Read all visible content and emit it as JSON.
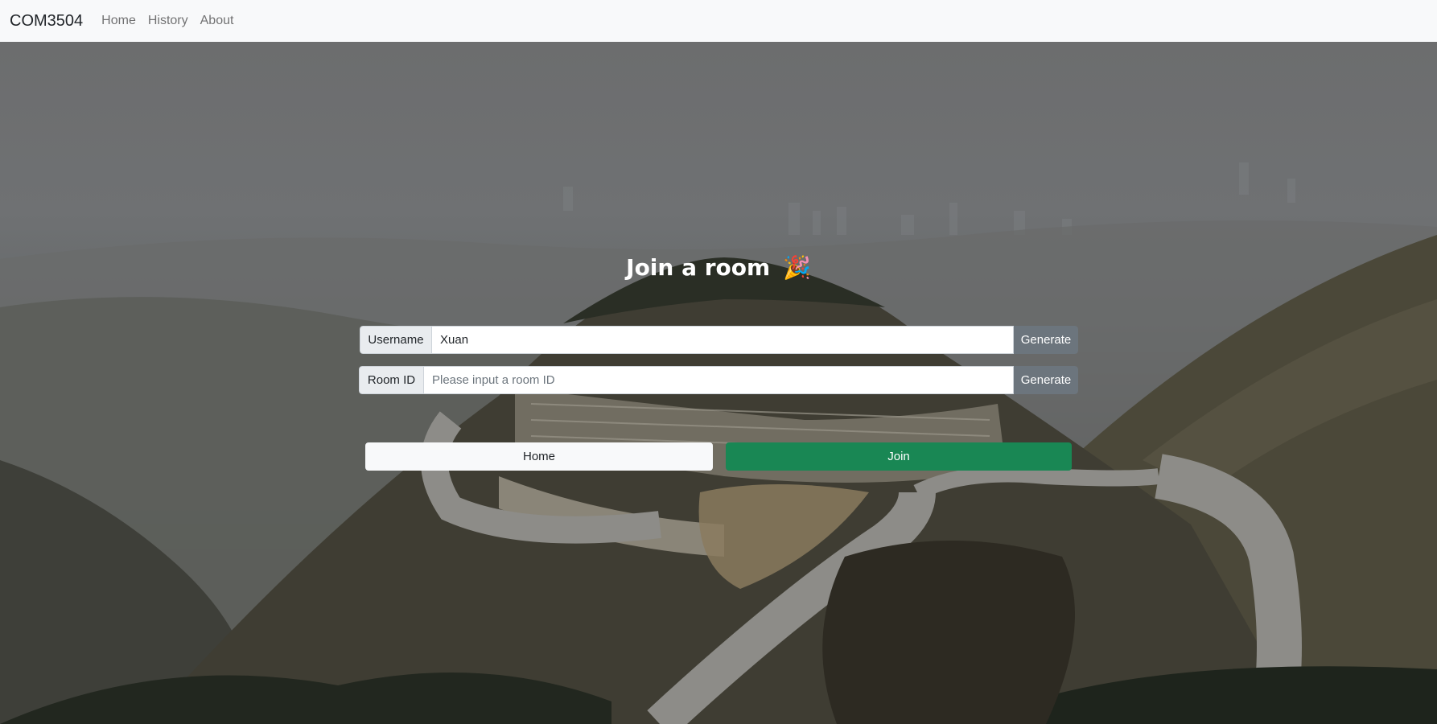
{
  "navbar": {
    "brand": "COM3504",
    "links": [
      "Home",
      "History",
      "About"
    ]
  },
  "form": {
    "title": "Join a room",
    "title_emoji": "🎉",
    "username": {
      "label": "Username",
      "value": "Xuan",
      "generate_label": "Generate"
    },
    "room": {
      "label": "Room ID",
      "placeholder": "Please input a room ID",
      "value": "",
      "generate_label": "Generate"
    },
    "home_label": "Home",
    "join_label": "Join"
  },
  "colors": {
    "navbar_bg": "#f8f9fa",
    "join_button": "#198754",
    "generate_button": "#6c757d"
  }
}
